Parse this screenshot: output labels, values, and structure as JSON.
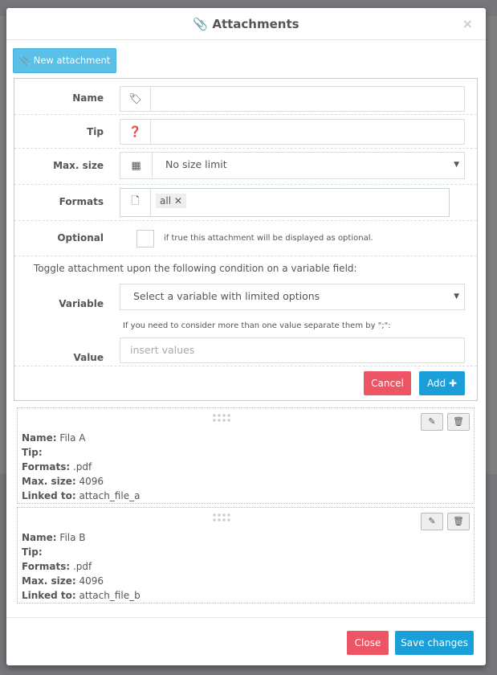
{
  "modal": {
    "title": "Attachments",
    "close": "×",
    "new_attachment": "New attachment"
  },
  "form": {
    "name_label": "Name",
    "name_value": "",
    "tip_label": "Tip",
    "tip_value": "",
    "maxsize_label": "Max. size",
    "maxsize_value": "No size limit",
    "formats_label": "Formats",
    "formats_tags": [
      "all"
    ],
    "optional_label": "Optional",
    "optional_checked": false,
    "optional_hint": "if true this attachment will be displayed as optional.",
    "toggle_text": "Toggle attachment upon the following condition on a variable field:",
    "variable_label": "Variable",
    "variable_value": "Select a variable with limited options",
    "value_hint": "If you need to consider more than one value separate them by \";\":",
    "value_label": "Value",
    "value_placeholder": "insert values",
    "cancel": "Cancel",
    "add": "Add"
  },
  "attachments": [
    {
      "name": "Fila A",
      "tip": "",
      "formats": ".pdf",
      "max_size": "4096",
      "linked_to": "attach_file_a"
    },
    {
      "name": "Fila B",
      "tip": "",
      "formats": ".pdf",
      "max_size": "4096",
      "linked_to": "attach_file_b"
    }
  ],
  "field_labels": {
    "name": "Name:",
    "tip": "Tip:",
    "formats": "Formats:",
    "max_size": "Max. size:",
    "linked_to": "Linked to:"
  },
  "footer": {
    "close": "Close",
    "save": "Save changes"
  },
  "colors": {
    "primary": "#1a9fd9",
    "danger": "#ed5565",
    "info": "#5bc0e8"
  }
}
